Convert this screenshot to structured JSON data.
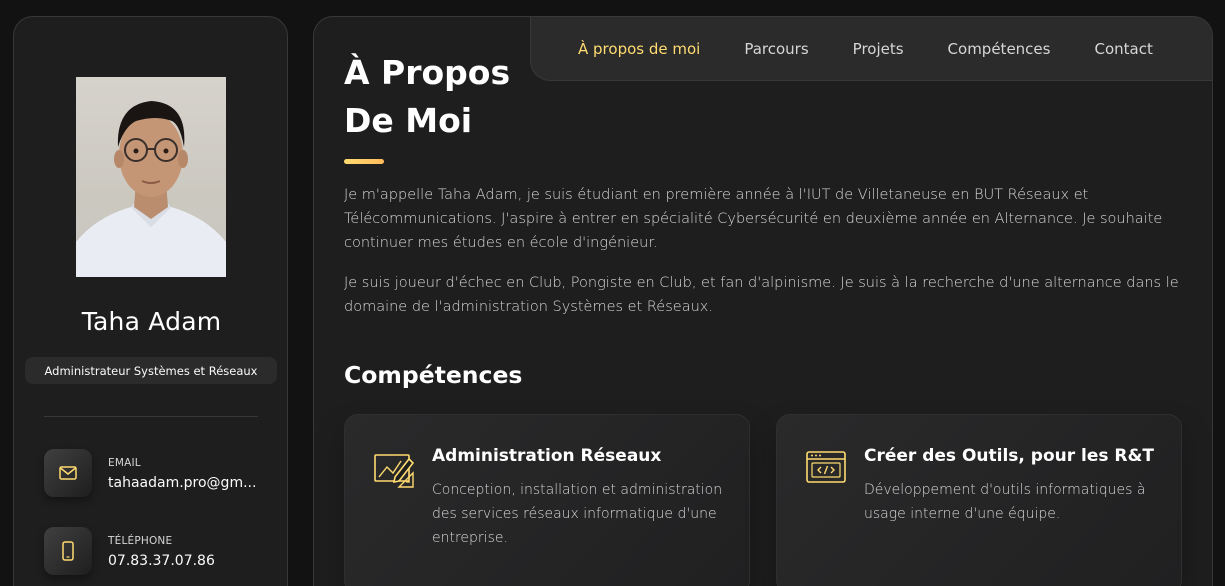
{
  "sidebar": {
    "name": "Taha Adam",
    "title": "Administrateur Systèmes et Réseaux",
    "contacts": [
      {
        "label": "Email",
        "value": "tahaadam.pro@gm...",
        "icon": "mail-icon"
      },
      {
        "label": "Téléphone",
        "value": "07.83.37.07.86",
        "icon": "phone-icon"
      }
    ]
  },
  "nav": {
    "items": [
      "À propos de moi",
      "Parcours",
      "Projets",
      "Compétences",
      "Contact"
    ],
    "active": "À propos de moi"
  },
  "about": {
    "title_line1": "À Propos",
    "title_line2": "De Moi",
    "paragraphs": [
      "Je m'appelle Taha Adam, je suis étudiant en première année à l'IUT de Villetaneuse en BUT Réseaux et Télécommunications. J'aspire à entrer en spécialité Cybersécurité en deuxième année en Alternance. Je souhaite continuer mes études en école d'ingénieur.",
      "Je suis joueur d'échec en Club, Pongiste en Club, et fan d'alpinisme. Je suis à la recherche d'une alternance dans le domaine de l'administration Systèmes et Réseaux."
    ]
  },
  "skills": {
    "heading": "Compétences",
    "cards": [
      {
        "title": "Administration Réseaux",
        "description": "Conception, installation et administration des services réseaux informatique d'une entreprise.",
        "icon": "design-pencil-icon"
      },
      {
        "title": "Créer des Outils, pour les R&T",
        "description": "Développement d'outils informatiques à usage interne d'une équipe.",
        "icon": "code-window-icon"
      }
    ]
  },
  "colors": {
    "accent": "#ffdb70",
    "background": "#121212",
    "card": "#1e1e1f",
    "text": "#d6d6d6"
  }
}
